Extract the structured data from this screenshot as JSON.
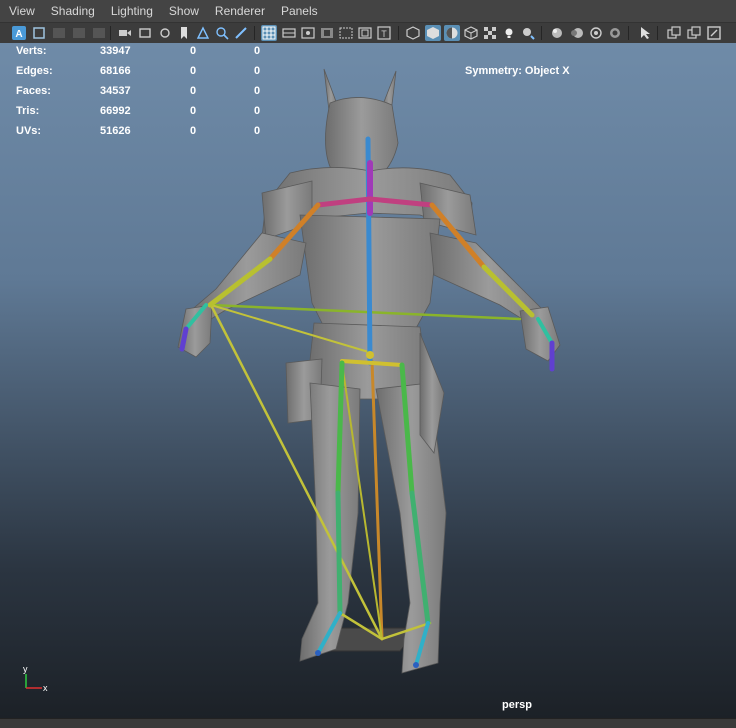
{
  "menu": [
    "View",
    "Shading",
    "Lighting",
    "Show",
    "Renderer",
    "Panels"
  ],
  "hud": {
    "rows": [
      {
        "label": "Verts:",
        "v1": "33947",
        "v2": "0",
        "v3": "0"
      },
      {
        "label": "Edges:",
        "v1": "68166",
        "v2": "0",
        "v3": "0"
      },
      {
        "label": "Faces:",
        "v1": "34537",
        "v2": "0",
        "v3": "0"
      },
      {
        "label": "Tris:",
        "v1": "66992",
        "v2": "0",
        "v3": "0"
      },
      {
        "label": "UVs:",
        "v1": "51626",
        "v2": "0",
        "v3": "0"
      }
    ],
    "symmetry": "Symmetry: Object X",
    "camera": "persp",
    "axis": {
      "y": "y",
      "x": "x"
    }
  },
  "toolbar": {
    "icons": [
      "select-camera-icon",
      "camera-attributes-icon",
      "bookmark-icon",
      "image-plane-icon",
      "2d-pan-zoom-icon",
      "grease-pencil-icon",
      "grid-icon",
      "film-gate-icon",
      "resolution-gate-icon",
      "gate-mask-icon",
      "field-chart-icon",
      "safe-action-icon",
      "safe-title-icon",
      "wireframe-icon",
      "smooth-shade-icon",
      "wireframe-on-shaded-icon",
      "textured-icon",
      "use-lights-icon",
      "shadows-icon",
      "screen-space-ao-icon",
      "motion-blur-icon",
      "isolate-select-icon",
      "xray-icon",
      "xray-joints-icon",
      "hud-toggle-icon",
      "panel-layout-icon",
      "maximize-icon"
    ]
  },
  "colors": {
    "viewport_top": "#6f8ba8",
    "viewport_bottom": "#1c2127",
    "active_button": "#5a8fb5"
  }
}
